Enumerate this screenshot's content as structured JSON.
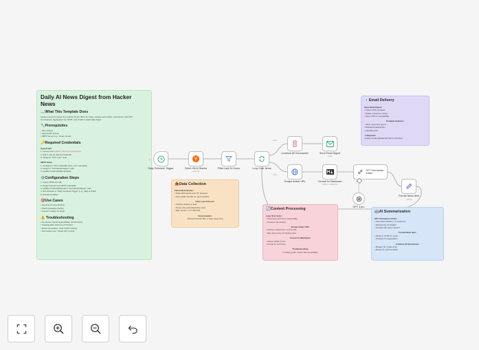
{
  "main_note": {
    "title": "Daily AI News Digest from Hacker News",
    "sections": [
      {
        "heading": "📖What This Template Does",
        "lines": [
          "Fetches recent AI stories from Hacker News, filters for today, scrapes each article, summarizes with GPT-",
          "4o-mini/pass, aggregates into HTML, and emails a styled daily digest."
        ]
      },
      {
        "heading": "🔧Prerequisites",
        "lines": [
          "• n8n instance",
          "• OpenAI API access",
          "• SMTP server (e.g., Gmail, Gmail)"
        ]
      },
      {
        "heading": "🔑Required Credentials",
        "lines": []
      }
    ],
    "openai_label": "OpenAI API",
    "openai_lines": [
      "1. Get key from",
      "2. Add to n8n as OpenAI credential",
      "3. Assign to \"GPT 4.pro\" node"
    ],
    "openai_link": "platform.openai.com/api-keys",
    "smtp_label": "SMTP Setup",
    "smtp_lines": [
      "1. Configure in n8n credentials (host, port, user/pass)",
      "2. Assign to \"Send Email Digest\" node",
      "3. Update fromEmail/toEmail fields"
    ],
    "config_heading": "⚙️Configuration Steps",
    "config_lines": [
      "1. Import JSON into n8n",
      "2. Assign OpenAI and SMTP credentials",
      "3. Update fromEmail/toEmail in \"Send Email Digest\" node",
      "4. Set schedule in \"Daily Schedule Trigger\" (e.g., daily at 8 AM)",
      "5. Activate workflow"
    ],
    "use_heading": "🎯Use Cases",
    "use_lines": [
      "• Personal AI news briefing",
      "• Team knowledge sharing",
      "• Content curation for blogs"
    ],
    "trouble_heading": "⚠️ Troubleshooting",
    "trouble_lines": [
      "• No stories: Check keyword/filter; HN API limits",
      "• Scraping fails: Add proxy if blocked",
      "• Email not sending: Verify SMTP settings",
      "• Summaries poor: Tweak GPT prompt"
    ]
  },
  "data_collection": {
    "title": "📥Data Collection",
    "blocks": [
      {
        "label": "Fetch HN AI Stories:",
        "lines": [
          "• Pulls 1000 stories with \"AI\" keyword",
          "• Uses public HN API (no auth needed)"
        ]
      },
      {
        "label": "Filter Last 24 Hours:",
        "lines": [
          "• Checks created_at field",
          "• Keeps only yesterday/today posts",
          "• Date format: YYYY-MM-DD"
        ]
      },
      {
        "label": "Customization:",
        "lines": [
          "Change keyword filter or date range here"
        ]
      }
    ]
  },
  "content_processing": {
    "title": "🔄Content Processing",
    "blocks": [
      {
        "label": "Loop Over Items:",
        "lines": [
          "• Processes each story sequentially",
          "• Prevents rate limiting"
        ]
      },
      {
        "label": "Scrape Article URL:",
        "lines": [
          "• Fetches content from source URL",
          "• May need proxy for blocked sites"
        ]
      },
      {
        "label": "Convert to Markdown:",
        "lines": [
          "• Cleans HTML to text",
          "• Format for LLM input"
        ]
      },
      {
        "label": "Troubleshooting:",
        "lines": [
          "If scraping fails, check URL accessibility"
        ]
      }
    ]
  },
  "email_delivery": {
    "title": "📧Email Delivery",
    "blocks": [
      {
        "label": "Send Email Digest:",
        "lines": [
          "• Styled HTML template",
          "• Mobile responsive design",
          "• Inline CSS for compatibility"
        ]
      },
      {
        "label": "Template Features:",
        "lines": [
          "• Clean news item layout",
          "• Branded header/footer",
          "• Clickable links"
        ]
      },
      {
        "label": "⚙️Required:",
        "lines": [
          "Update fromEmail/toEmail before activating"
        ]
      }
    ]
  },
  "ai_summarization": {
    "title": "🤖AI Summarization",
    "blocks": [
      {
        "label": "GPT Summarize Article:",
        "lines": [
          "• Generates heading + 1 sentences",
          "• Extracts key AI insights",
          "• Includes title when relevant"
        ]
      },
      {
        "label": "Format News Item:",
        "lines": [
          "• Wraps in HTML for email",
          "• Prepares for aggregation"
        ]
      },
      {
        "label": "Combine All Summaries:",
        "lines": [
          "• Merges into single array",
          "• Ready for email template"
        ]
      }
    ]
  },
  "nodes": {
    "trigger": {
      "label": "Daily Schedule Trigger"
    },
    "fetch": {
      "label": "Fetch HN AI Stories",
      "sub": "public api"
    },
    "filter": {
      "label": "Filter Last 24 Hours"
    },
    "loop": {
      "label": "Loop Over Items"
    },
    "combine": {
      "label": "Combine All Summaries"
    },
    "send": {
      "label": "Send Email Digest",
      "sub": "send"
    },
    "scrape": {
      "label": "Scrape Article URL"
    },
    "convert": {
      "label": "Convert to Markdown",
      "sub": "HTML to Markdown"
    },
    "summarize": {
      "label": "GPT Summarize Article",
      "sub": "Model",
      "model_label": "Model"
    },
    "gpt": {
      "label": "GPT 4.pro"
    },
    "format": {
      "label": "Format News Item",
      "sub": "manual"
    },
    "loop_done": "done",
    "loop_item": "loop"
  },
  "controls": {
    "fit": "fit-view",
    "zoom_in": "zoom-in",
    "zoom_out": "zoom-out",
    "undo": "undo"
  }
}
